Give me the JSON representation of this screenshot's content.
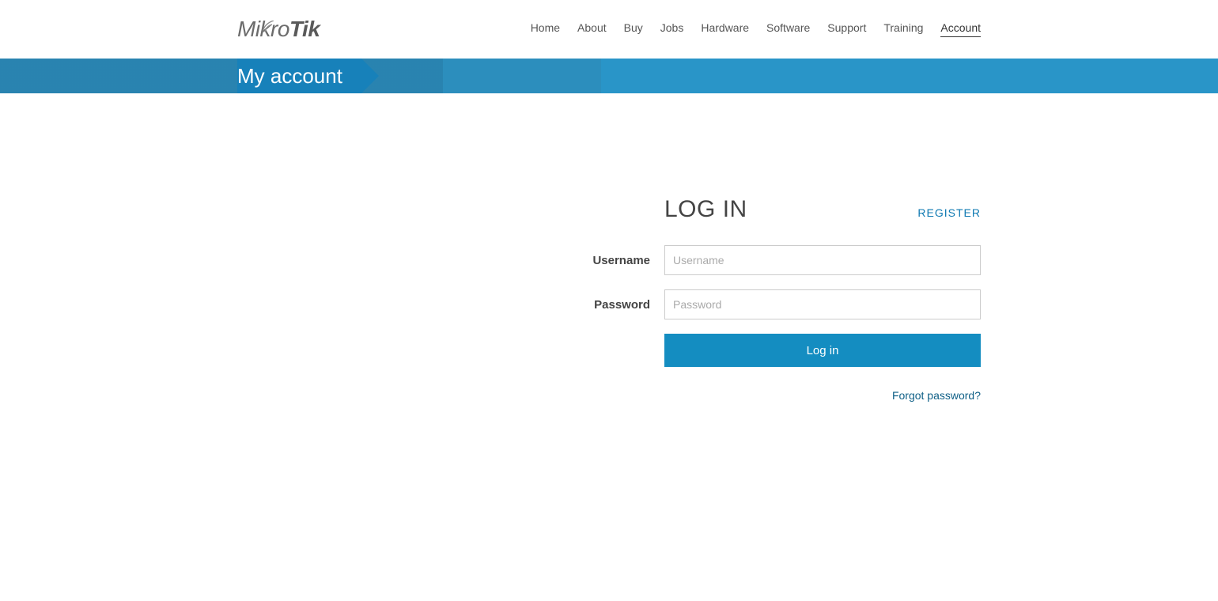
{
  "brand": {
    "part1": "Mikro",
    "part2": "Tik"
  },
  "nav": {
    "items": [
      {
        "label": "Home"
      },
      {
        "label": "About"
      },
      {
        "label": "Buy"
      },
      {
        "label": "Jobs"
      },
      {
        "label": "Hardware"
      },
      {
        "label": "Software"
      },
      {
        "label": "Support"
      },
      {
        "label": "Training"
      },
      {
        "label": "Account",
        "active": true
      }
    ]
  },
  "page_title": "My account",
  "login": {
    "heading": "LOG IN",
    "register_link": "REGISTER",
    "username_label": "Username",
    "username_placeholder": "Username",
    "password_label": "Password",
    "password_placeholder": "Password",
    "submit_label": "Log in",
    "forgot_link": "Forgot password?"
  },
  "colors": {
    "accent": "#148dc1",
    "link": "#0e79b2"
  }
}
